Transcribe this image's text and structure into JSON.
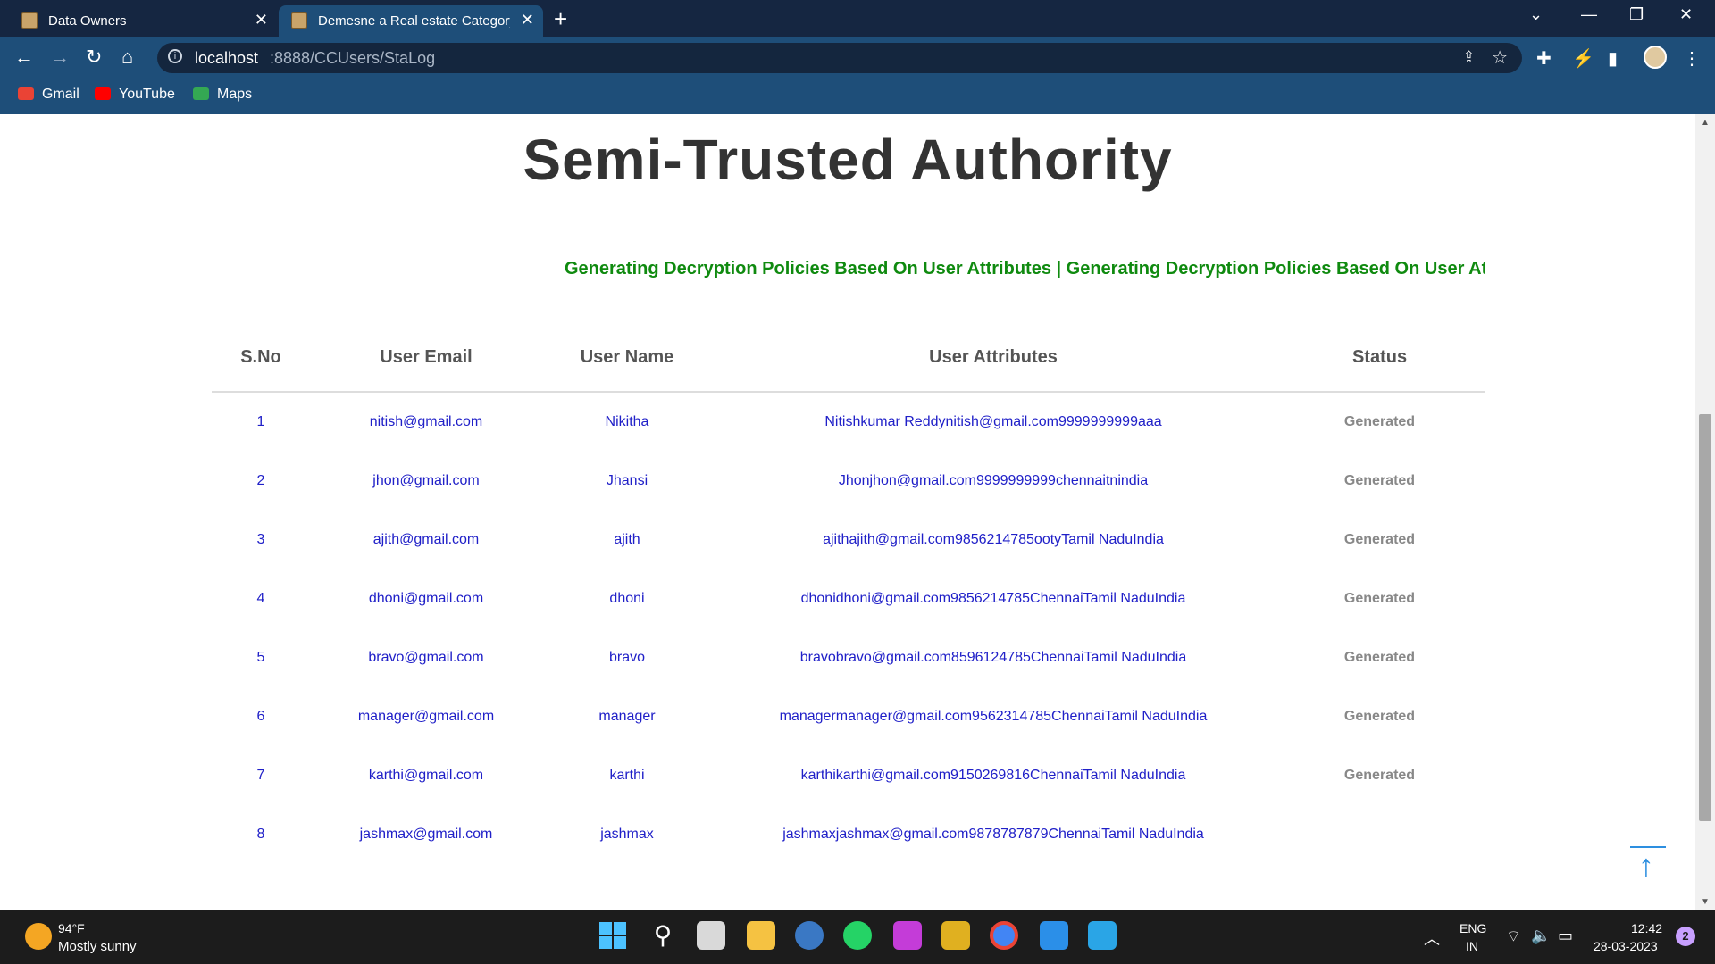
{
  "browser": {
    "tabs": [
      {
        "title": "Data Owners",
        "active": false
      },
      {
        "title": "Demesne a Real estate Category",
        "active": true
      }
    ],
    "url_host": "localhost",
    "url_path": ":8888/CCUsers/StaLog",
    "bookmarks": [
      {
        "label": "Gmail",
        "color": "#ea4335"
      },
      {
        "label": "YouTube",
        "color": "#ff0000"
      },
      {
        "label": "Maps",
        "color": "#34a853"
      }
    ]
  },
  "page": {
    "title": "Semi-Trusted Authority",
    "marquee": "Generating Decryption Policies Based On User Attributes | Generating Decryption Policies Based On User Attributes"
  },
  "table": {
    "headers": [
      "S.No",
      "User Email",
      "User Name",
      "User Attributes",
      "Status"
    ],
    "rows": [
      [
        "1",
        "nitish@gmail.com",
        "Nikitha",
        "Nitishkumar Reddynitish@gmail.com9999999999aaa",
        "Generated"
      ],
      [
        "2",
        "jhon@gmail.com",
        "Jhansi",
        "Jhonjhon@gmail.com9999999999chennaitnindia",
        "Generated"
      ],
      [
        "3",
        "ajith@gmail.com",
        "ajith",
        "ajithajith@gmail.com9856214785ootyTamil NaduIndia",
        "Generated"
      ],
      [
        "4",
        "dhoni@gmail.com",
        "dhoni",
        "dhonidhoni@gmail.com9856214785ChennaiTamil NaduIndia",
        "Generated"
      ],
      [
        "5",
        "bravo@gmail.com",
        "bravo",
        "bravobravo@gmail.com8596124785ChennaiTamil NaduIndia",
        "Generated"
      ],
      [
        "6",
        "manager@gmail.com",
        "manager",
        "managermanager@gmail.com9562314785ChennaiTamil NaduIndia",
        "Generated"
      ],
      [
        "7",
        "karthi@gmail.com",
        "karthi",
        "karthikarthi@gmail.com9150269816ChennaiTamil NaduIndia",
        "Generated"
      ],
      [
        "8",
        "jashmax@gmail.com",
        "jashmax",
        "jashmaxjashmax@gmail.com9878787879ChennaiTamil NaduIndia",
        ""
      ]
    ]
  },
  "taskbar": {
    "temperature": "94°F",
    "weather": "Mostly sunny",
    "lang_top": "ENG",
    "lang_bottom": "IN",
    "time": "12:42",
    "date": "28-03-2023",
    "notifications": "2"
  }
}
